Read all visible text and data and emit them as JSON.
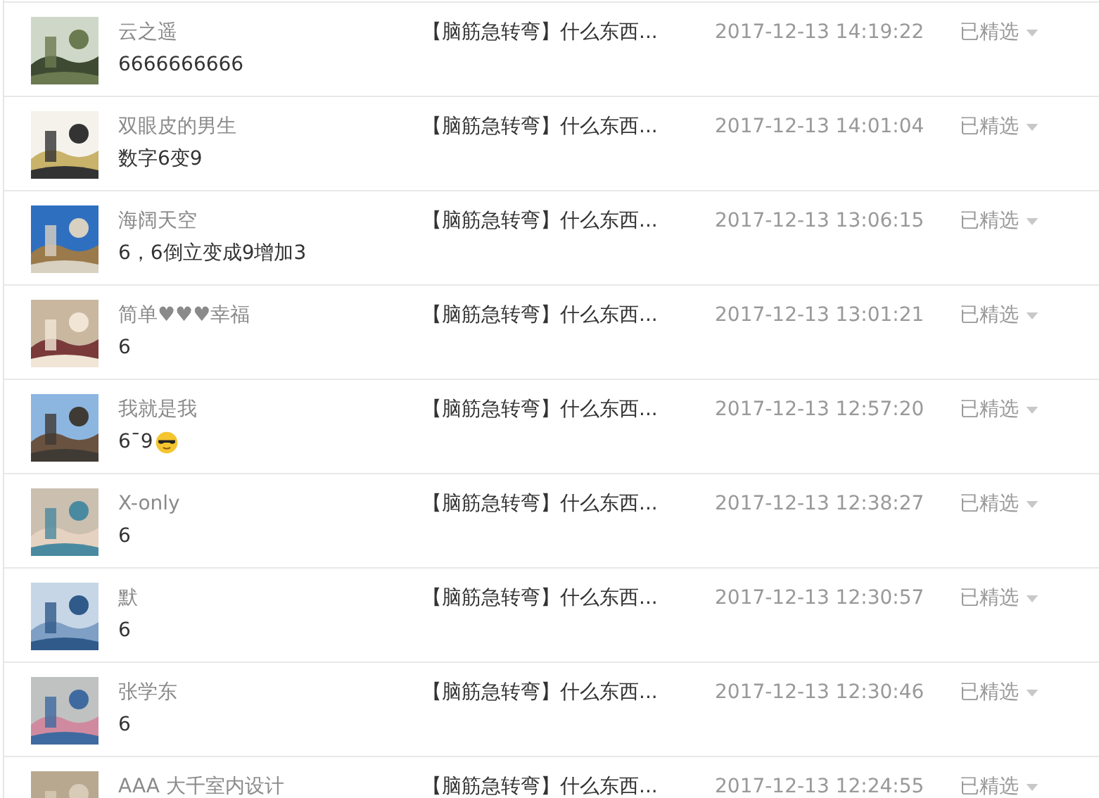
{
  "rows": [
    {
      "name": "云之遥",
      "comment": "6666666666",
      "title": "【脑筋急转弯】什么东西...",
      "time": "2017-12-13 14:19:22",
      "status": "已精选"
    },
    {
      "name": "双眼皮的男生",
      "comment": "数字6变9",
      "title": "【脑筋急转弯】什么东西...",
      "time": "2017-12-13 14:01:04",
      "status": "已精选"
    },
    {
      "name": "海阔天空",
      "comment": "6，6倒立变成9增加3",
      "title": "【脑筋急转弯】什么东西...",
      "time": "2017-12-13 13:06:15",
      "status": "已精选"
    },
    {
      "name": "简单♥♥♥幸福",
      "comment": "6",
      "title": "【脑筋急转弯】什么东西...",
      "time": "2017-12-13 13:01:21",
      "status": "已精选"
    },
    {
      "name": "我就是我",
      "comment": "6¯9",
      "sunglasses_emoji": true,
      "title": "【脑筋急转弯】什么东西...",
      "time": "2017-12-13 12:57:20",
      "status": "已精选"
    },
    {
      "name": "X-only",
      "comment": "6",
      "title": "【脑筋急转弯】什么东西...",
      "time": "2017-12-13 12:38:27",
      "status": "已精选"
    },
    {
      "name": "默",
      "comment": "6",
      "title": "【脑筋急转弯】什么东西...",
      "time": "2017-12-13 12:30:57",
      "status": "已精选"
    },
    {
      "name": "张学东",
      "comment": "6",
      "title": "【脑筋急转弯】什么东西...",
      "time": "2017-12-13 12:30:46",
      "status": "已精选"
    },
    {
      "name": "AAA 大千室内设计",
      "title": "【脑筋急转弯】什么东西...",
      "time": "2017-12-13 12:24:55",
      "status": "已精选"
    }
  ]
}
